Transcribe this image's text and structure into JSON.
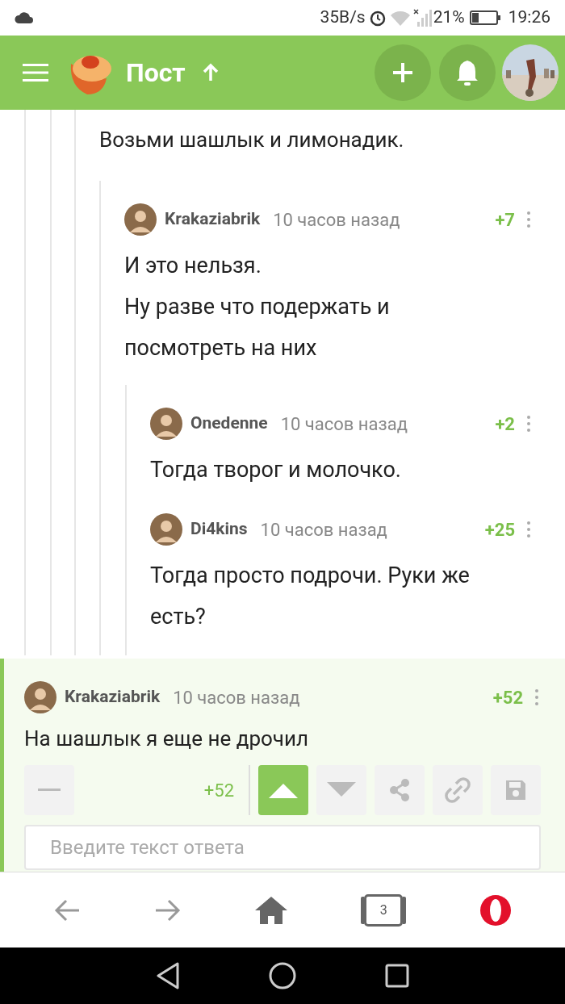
{
  "status_bar": {
    "speed": "35B/s",
    "battery": "21%",
    "time": "19:26"
  },
  "header": {
    "title": "Пост"
  },
  "thread_text": "Возьми шашлык и лимонадик.",
  "comments": [
    {
      "author": "Krakaziabrik",
      "time": "10 часов назад",
      "rating": "+7",
      "lines": [
        "И это нельзя.",
        "Ну разве что подержать и посмотреть на них"
      ],
      "children": [
        {
          "author": "Onedenne",
          "time": "10 часов назад",
          "rating": "+2",
          "lines": [
            "Тогда творог и молочко."
          ]
        },
        {
          "author": "Di4kins",
          "time": "10 часов назад",
          "rating": "+25",
          "lines": [
            "Тогда просто подрочи. Руки же есть?"
          ]
        }
      ]
    }
  ],
  "current_comment": {
    "author": "Krakaziabrik",
    "time": "10 часов назад",
    "rating": "+52",
    "text": "На шашлык я еще не дрочил",
    "votes": {
      "score": "+52",
      "upvoted": true,
      "downvoted": false
    },
    "reply": {
      "placeholder": "Введите текст ответа"
    }
  },
  "browser_bar": {
    "tabs_count": "3"
  }
}
